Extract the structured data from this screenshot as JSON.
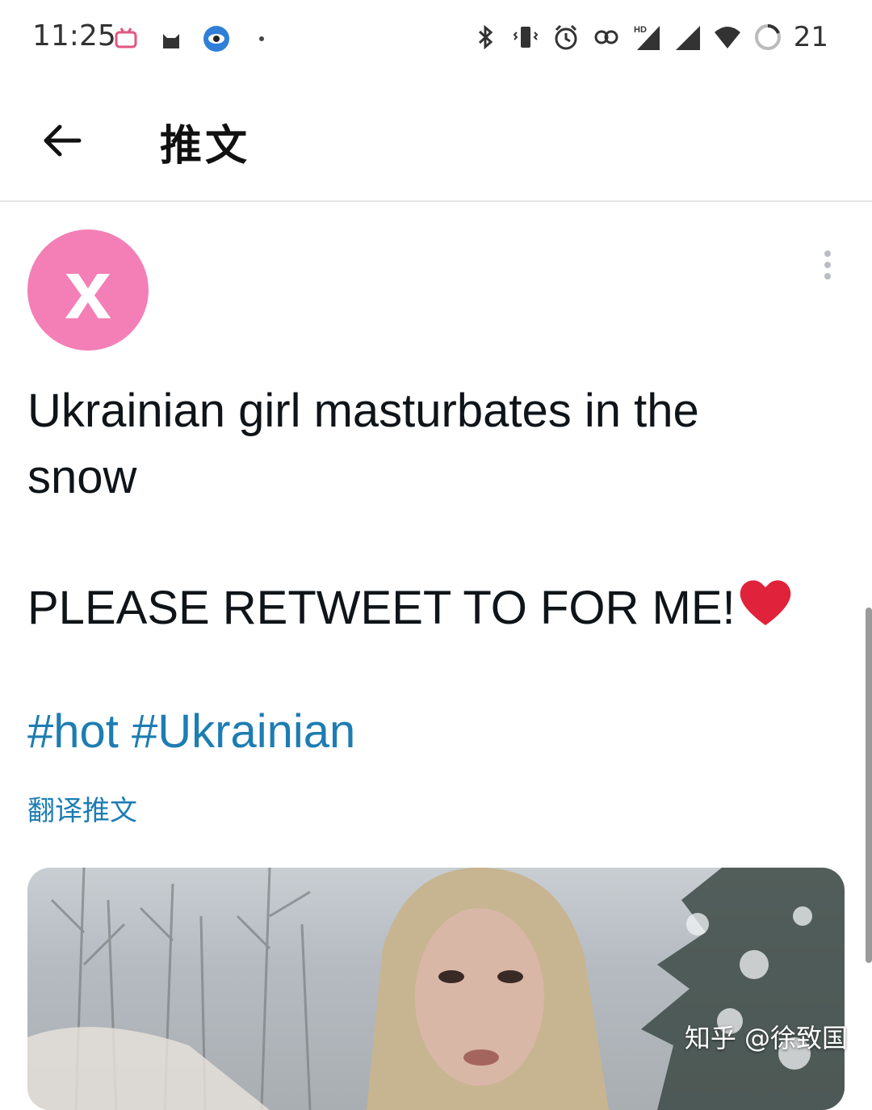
{
  "status_bar": {
    "time": "11:25",
    "battery_percent": "21",
    "left_icons": [
      "bilibili-icon",
      "cat-icon",
      "eye-app-icon",
      "dot-icon"
    ],
    "right_icons": [
      "bluetooth-icon",
      "vibrate-icon",
      "alarm-icon",
      "link-icon",
      "hd-signal-icon",
      "signal-icon",
      "wifi-icon",
      "battery-ring-icon"
    ],
    "hd_label": "HD"
  },
  "header": {
    "title": "推文",
    "back_icon": "arrow-left-icon"
  },
  "tweet": {
    "avatar_letter": "x",
    "avatar_color": "#f37fb6",
    "text_line1": "Ukrainian girl masturbates in the snow",
    "text_line2": "PLEASE RETWEET TO FOR ME!",
    "hashtags": [
      "#hot",
      "#Ukrainian"
    ],
    "translate_label": "翻译推文",
    "link_color": "#1d7db3",
    "heart_color": "#e0233a"
  },
  "watermark": "知乎 @徐致国"
}
